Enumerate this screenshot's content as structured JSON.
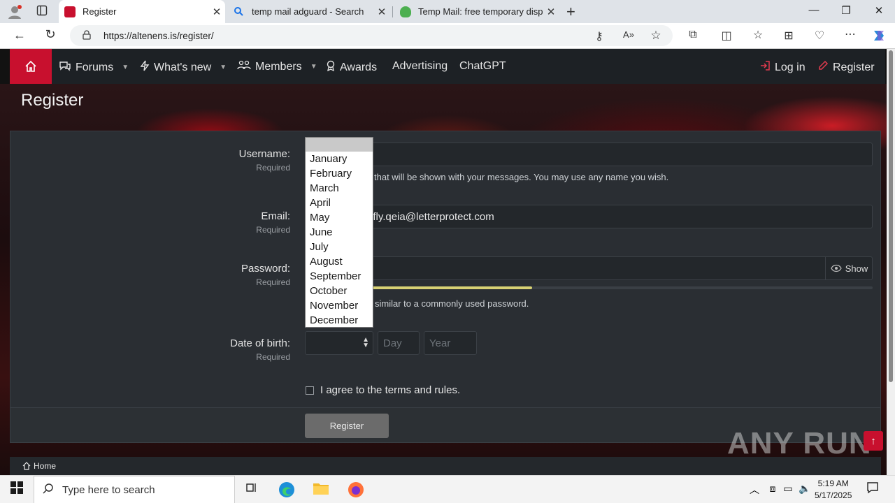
{
  "browser": {
    "tabs": [
      {
        "title": "Register",
        "active": true
      },
      {
        "title": "temp mail adguard - Search",
        "active": false
      },
      {
        "title": "Temp Mail: free temporary dispo",
        "active": false
      }
    ],
    "url": "https://altenens.is/register/"
  },
  "nav": {
    "items": [
      "Forums",
      "What's new",
      "Members",
      "Awards",
      "Advertising",
      "ChatGPT"
    ],
    "login": "Log in",
    "register": "Register"
  },
  "page": {
    "title": "Register"
  },
  "form": {
    "username_label": "Username:",
    "username_hint": "that will be shown with your messages. You may use any name you wish.",
    "email_label": "Email:",
    "email_value": "efly.qeia@letterprotect.com",
    "password_label": "Password:",
    "show_label": "Show",
    "password_hint": "similar to a commonly used password.",
    "password_strength": 0.4,
    "required": "Required",
    "dob_label": "Date of birth:",
    "day_placeholder": "Day",
    "year_placeholder": "Year",
    "terms_label": "I agree to the terms and rules.",
    "submit_label": "Register"
  },
  "month_dropdown": {
    "options": [
      "January",
      "February",
      "March",
      "April",
      "May",
      "June",
      "July",
      "August",
      "September",
      "October",
      "November",
      "December"
    ]
  },
  "breadcrumb": {
    "home": "Home"
  },
  "watermark": "ANY RUN",
  "taskbar": {
    "search_placeholder": "Type here to search",
    "time": "5:19 AM",
    "date": "5/17/2025"
  },
  "colors": {
    "accent": "#c8102e",
    "strength": "#d8d174"
  }
}
